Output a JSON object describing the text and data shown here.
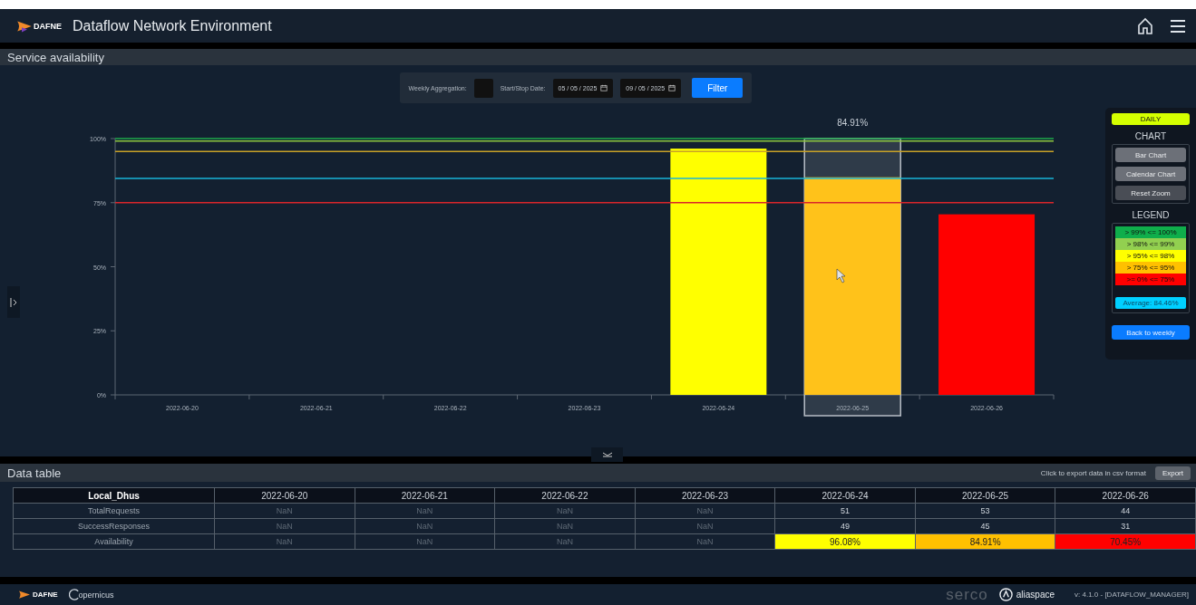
{
  "header": {
    "logo": "DAFNE",
    "title": "Dataflow Network Environment"
  },
  "availability": {
    "title": "Service availability",
    "filter": {
      "weekly_label": "Weekly Aggregation:",
      "weekly_checked": false,
      "date_label": "Start/Stop Date:",
      "start": "05 / 05 / 2025",
      "stop": "09 / 05 / 2025",
      "button": "Filter"
    },
    "chart_data": {
      "type": "bar",
      "categories": [
        "2022-06-20",
        "2022-06-21",
        "2022-06-22",
        "2022-06-23",
        "2022-06-24",
        "2022-06-25",
        "2022-06-26"
      ],
      "ylim": [
        0,
        100
      ],
      "yticks": [
        {
          "value": 0,
          "label": "0%"
        },
        {
          "value": 25,
          "label": "25%"
        },
        {
          "value": 50,
          "label": "50%"
        },
        {
          "value": 75,
          "label": "75%"
        },
        {
          "value": 100,
          "label": "100%"
        }
      ],
      "series": [
        {
          "color": "#ffff00",
          "values": [
            null,
            null,
            null,
            null,
            96.08,
            null,
            null
          ]
        },
        {
          "color": "#ffc21a",
          "values": [
            null,
            null,
            null,
            null,
            null,
            84.91,
            null
          ]
        },
        {
          "color": "#ff0000",
          "values": [
            null,
            null,
            null,
            null,
            null,
            null,
            70.45
          ]
        }
      ],
      "ref_lines": [
        {
          "axis": "y",
          "value": 100,
          "color": "#1fa84a"
        },
        {
          "axis": "y",
          "value": 99,
          "color": "#8cc63f"
        },
        {
          "axis": "y",
          "value": 95,
          "color": "#c9a227"
        },
        {
          "axis": "y",
          "value": 75,
          "color": "#d9262b"
        },
        {
          "axis": "y",
          "value": 84.46,
          "color": "#19b5d8"
        }
      ],
      "annotations": [
        {
          "x": "2022-06-25",
          "y": 100,
          "text": "84.91%"
        }
      ]
    },
    "panel": {
      "mode": "DAILY",
      "chart_title": "CHART",
      "chart_buttons": [
        {
          "label": "Bar Chart",
          "selected": false
        },
        {
          "label": "Calendar Chart",
          "selected": false
        },
        {
          "label": "Reset Zoom",
          "selected": true
        }
      ],
      "legend_title": "LEGEND",
      "legend": [
        {
          "label": "> 99% <= 100%",
          "color": "#0fae4b"
        },
        {
          "label": "> 98% <= 99%",
          "color": "#92d050"
        },
        {
          "label": "> 95% <= 98%",
          "color": "#ffff00"
        },
        {
          "label": "> 75% <= 95%",
          "color": "#ffc000"
        },
        {
          "label": ">= 0% <= 75%",
          "color": "#ff0000"
        }
      ],
      "average": "Average: 84.46%",
      "back": "Back to weekly"
    }
  },
  "data_table": {
    "title": "Data table",
    "export_hint": "Click to export data in csv format",
    "export_button": "Export",
    "columns": [
      "Local_Dhus",
      "2022-06-20",
      "2022-06-21",
      "2022-06-22",
      "2022-06-23",
      "2022-06-24",
      "2022-06-25",
      "2022-06-26"
    ],
    "rows": [
      {
        "cells": [
          {
            "text": "TotalRequests",
            "kind": "label"
          },
          {
            "text": "NaN",
            "kind": "empty"
          },
          {
            "text": "NaN",
            "kind": "empty"
          },
          {
            "text": "NaN",
            "kind": "empty"
          },
          {
            "text": "NaN",
            "kind": "empty"
          },
          {
            "text": "51",
            "kind": "value"
          },
          {
            "text": "53",
            "kind": "value"
          },
          {
            "text": "44",
            "kind": "value"
          }
        ]
      },
      {
        "cells": [
          {
            "text": "SuccessResponses",
            "kind": "label"
          },
          {
            "text": "NaN",
            "kind": "empty"
          },
          {
            "text": "NaN",
            "kind": "empty"
          },
          {
            "text": "NaN",
            "kind": "empty"
          },
          {
            "text": "NaN",
            "kind": "empty"
          },
          {
            "text": "49",
            "kind": "value"
          },
          {
            "text": "45",
            "kind": "value"
          },
          {
            "text": "31",
            "kind": "value"
          }
        ]
      },
      {
        "cells": [
          {
            "text": "Availability",
            "kind": "label"
          },
          {
            "text": "NaN",
            "kind": "empty"
          },
          {
            "text": "NaN",
            "kind": "empty"
          },
          {
            "text": "NaN",
            "kind": "empty"
          },
          {
            "text": "NaN",
            "kind": "empty"
          },
          {
            "text": "96.08%",
            "kind": "value",
            "color": "#ffff00"
          },
          {
            "text": "84.91%",
            "kind": "value",
            "color": "#ffc000"
          },
          {
            "text": "70.45%",
            "kind": "value",
            "color": "#ff0000"
          }
        ]
      }
    ]
  },
  "footer": {
    "logo": "DAFNE",
    "copernicus": "opernicus",
    "serco": "serco",
    "aliaspace": "aliaspace",
    "version": "v: 4.1.0 - [DATAFLOW_MANAGER]"
  }
}
